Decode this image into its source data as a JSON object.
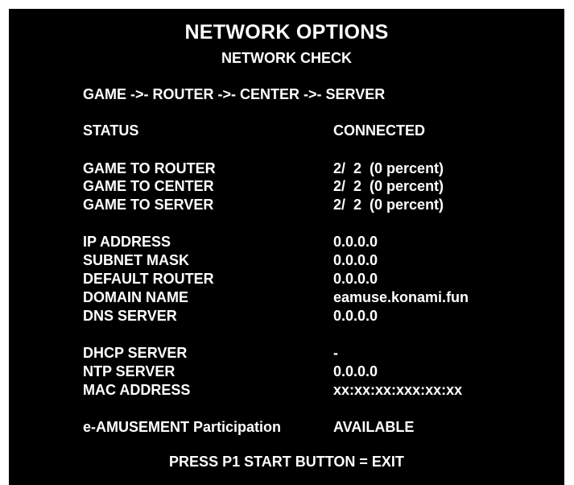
{
  "header": {
    "title": "NETWORK OPTIONS",
    "subtitle": "NETWORK CHECK"
  },
  "path_text": "GAME ->- ROUTER ->- CENTER ->- SERVER",
  "status": {
    "label": "STATUS",
    "value": "CONNECTED"
  },
  "connectivity": [
    {
      "label": "GAME TO ROUTER",
      "value": "2/  2  (0 percent)"
    },
    {
      "label": "GAME TO CENTER",
      "value": "2/  2  (0 percent)"
    },
    {
      "label": "GAME TO SERVER",
      "value": "2/  2  (0 percent)"
    }
  ],
  "network": [
    {
      "label": "IP ADDRESS",
      "value": "0.0.0.0"
    },
    {
      "label": "SUBNET MASK",
      "value": "0.0.0.0"
    },
    {
      "label": "DEFAULT ROUTER",
      "value": "0.0.0.0"
    },
    {
      "label": "DOMAIN NAME",
      "value": "eamuse.konami.fun"
    },
    {
      "label": "DNS SERVER",
      "value": "0.0.0.0"
    }
  ],
  "servers": [
    {
      "label": "DHCP SERVER",
      "value": "-"
    },
    {
      "label": "NTP SERVER",
      "value": "0.0.0.0"
    },
    {
      "label": "MAC ADDRESS",
      "value": "xx:xx:xx:xxx:xx:xx"
    }
  ],
  "participation": {
    "label": "e-AMUSEMENT Participation",
    "value": "AVAILABLE"
  },
  "footer": {
    "exit_text": "PRESS P1 START BUTTON = EXIT"
  }
}
